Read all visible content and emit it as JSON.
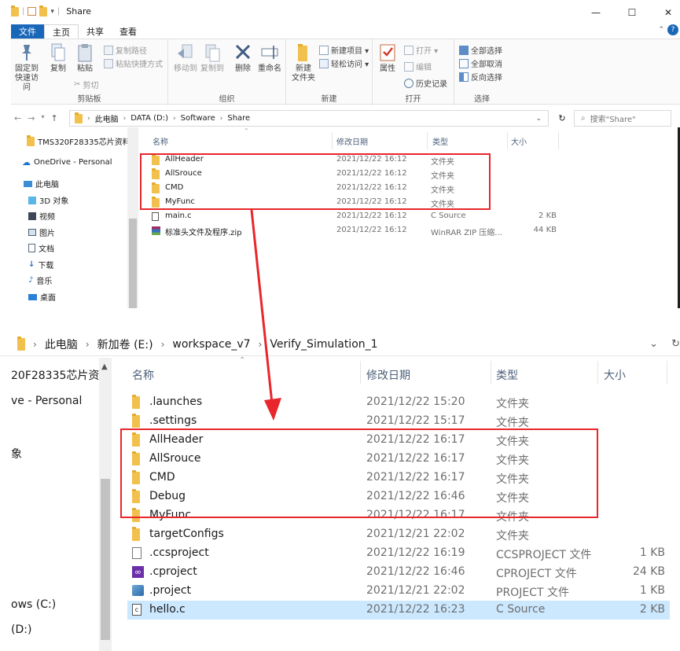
{
  "window1": {
    "title": "Share",
    "controls": {
      "minimize": "—",
      "maximize": "☐",
      "close": "✕"
    },
    "ribbon_tabs": [
      "文件",
      "主页",
      "共享",
      "查看"
    ],
    "ribbon": {
      "clipboard": {
        "pin": "固定到\n快速访问",
        "copy": "复制",
        "paste": "粘贴",
        "copy_path": "复制路径",
        "paste_shortcut": "粘贴快捷方式",
        "cut": "剪切",
        "label": "剪贴板"
      },
      "organize": {
        "move_to": "移动到",
        "copy_to": "复制到",
        "delete": "删除",
        "rename": "重命名",
        "label": "组织"
      },
      "new": {
        "new_folder": "新建\n文件夹",
        "new_item": "新建项目 ▾",
        "easy_access": "轻松访问 ▾",
        "label": "新建"
      },
      "open": {
        "properties": "属性",
        "open": "打开 ▾",
        "edit": "编辑",
        "history": "历史记录",
        "label": "打开"
      },
      "select": {
        "select_all": "全部选择",
        "select_none": "全部取消",
        "invert": "反向选择",
        "label": "选择"
      }
    },
    "address": [
      "此电脑",
      "DATA (D:)",
      "Software",
      "Share"
    ],
    "search_placeholder": "搜索\"Share\"",
    "nav": [
      {
        "label": "TMS320F28335芯片资料",
        "icon": "folder-icon"
      },
      {
        "label": "OneDrive - Personal",
        "icon": "cloud-icon"
      },
      {
        "label": "此电脑",
        "icon": "computer-icon"
      },
      {
        "label": "3D 对象",
        "icon": "cube-icon"
      },
      {
        "label": "视频",
        "icon": "video-icon"
      },
      {
        "label": "图片",
        "icon": "picture-icon"
      },
      {
        "label": "文档",
        "icon": "document-icon"
      },
      {
        "label": "下载",
        "icon": "download-icon"
      },
      {
        "label": "音乐",
        "icon": "music-icon"
      },
      {
        "label": "桌面",
        "icon": "desktop-icon"
      }
    ],
    "columns": [
      "名称",
      "修改日期",
      "类型",
      "大小"
    ],
    "files": [
      {
        "name": "AllHeader",
        "date": "2021/12/22 16:12",
        "type": "文件夹",
        "size": "",
        "icon": "folder-icon"
      },
      {
        "name": "AllSrouce",
        "date": "2021/12/22 16:12",
        "type": "文件夹",
        "size": "",
        "icon": "folder-icon"
      },
      {
        "name": "CMD",
        "date": "2021/12/22 16:12",
        "type": "文件夹",
        "size": "",
        "icon": "folder-icon"
      },
      {
        "name": "MyFunc",
        "date": "2021/12/22 16:12",
        "type": "文件夹",
        "size": "",
        "icon": "folder-icon"
      },
      {
        "name": "main.c",
        "date": "2021/12/22 16:12",
        "type": "C Source",
        "size": "2 KB",
        "icon": "c-file-icon"
      },
      {
        "name": "标准头文件及程序.zip",
        "date": "2021/12/22 16:12",
        "type": "WinRAR ZIP 压缩...",
        "size": "44 KB",
        "icon": "winrar-icon"
      }
    ]
  },
  "window2": {
    "address": [
      "此电脑",
      "新加卷 (E:)",
      "workspace_v7",
      "Verify_Simulation_1"
    ],
    "nav": [
      {
        "label": "20F28335芯片资"
      },
      {
        "label": "ve - Personal"
      },
      {
        "label": "象"
      },
      {
        "label": "ows (C:)"
      },
      {
        "label": "(D:)"
      }
    ],
    "columns": [
      "名称",
      "修改日期",
      "类型",
      "大小"
    ],
    "files": [
      {
        "name": ".launches",
        "date": "2021/12/22 15:20",
        "type": "文件夹",
        "size": "",
        "icon": "folder-icon"
      },
      {
        "name": ".settings",
        "date": "2021/12/22 15:17",
        "type": "文件夹",
        "size": "",
        "icon": "folder-icon"
      },
      {
        "name": "AllHeader",
        "date": "2021/12/22 16:17",
        "type": "文件夹",
        "size": "",
        "icon": "folder-icon"
      },
      {
        "name": "AllSrouce",
        "date": "2021/12/22 16:17",
        "type": "文件夹",
        "size": "",
        "icon": "folder-icon"
      },
      {
        "name": "CMD",
        "date": "2021/12/22 16:17",
        "type": "文件夹",
        "size": "",
        "icon": "folder-icon"
      },
      {
        "name": "Debug",
        "date": "2021/12/22 16:46",
        "type": "文件夹",
        "size": "",
        "icon": "folder-icon"
      },
      {
        "name": "MyFunc",
        "date": "2021/12/22 16:17",
        "type": "文件夹",
        "size": "",
        "icon": "folder-icon"
      },
      {
        "name": "targetConfigs",
        "date": "2021/12/21 22:02",
        "type": "文件夹",
        "size": "",
        "icon": "folder-icon"
      },
      {
        "name": ".ccsproject",
        "date": "2021/12/22 16:19",
        "type": "CCSPROJECT 文件",
        "size": "1 KB",
        "icon": "blank-file-icon"
      },
      {
        "name": ".cproject",
        "date": "2021/12/22 16:46",
        "type": "CPROJECT 文件",
        "size": "24 KB",
        "icon": "visual-studio-icon"
      },
      {
        "name": ".project",
        "date": "2021/12/21 22:02",
        "type": "PROJECT 文件",
        "size": "1 KB",
        "icon": "project-file-icon"
      },
      {
        "name": "hello.c",
        "date": "2021/12/22 16:23",
        "type": "C Source",
        "size": "2 KB",
        "icon": "c-file-icon",
        "selected": true
      }
    ]
  },
  "colors": {
    "annotation_red": "#e8262b",
    "folder_yellow": "#f2c14d",
    "selection_blue": "#cce8ff",
    "file_tab_blue": "#1a67b9"
  }
}
